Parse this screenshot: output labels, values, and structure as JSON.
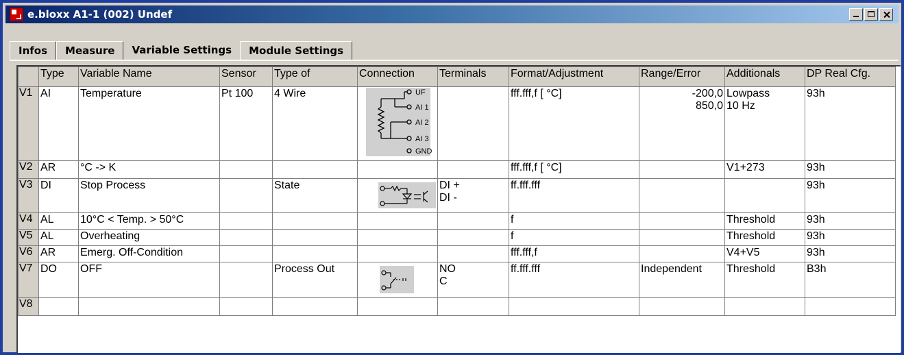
{
  "window": {
    "title": "e.bloxx A1-1 (002) Undef",
    "icon": "icp-app-icon",
    "controls": [
      "minimize",
      "maximize",
      "close"
    ]
  },
  "tabs": [
    {
      "label": "Infos",
      "active": false
    },
    {
      "label": "Measure",
      "active": false
    },
    {
      "label": "Variable Settings",
      "active": true
    },
    {
      "label": "Module Settings",
      "active": false
    }
  ],
  "grid": {
    "columns": [
      "",
      "Type",
      "Variable Name",
      "Sensor",
      "Type of",
      "Connection",
      "Terminals",
      "Format/Adjustment",
      "Range/Error",
      "Additionals",
      "DP Real Cfg."
    ],
    "rows": [
      {
        "id": "V1",
        "type": "AI",
        "name": "Temperature",
        "sensor": "Pt 100",
        "type_of": "4 Wire",
        "connection": "4-wire-rtd-diagram",
        "conn_labels": [
          "UF",
          "AI 1",
          "AI 2",
          "AI 3",
          "GND"
        ],
        "terminals": [
          "",
          ""
        ],
        "format": "fff.fff,f [ °C]",
        "range": [
          "-200,0",
          "850,0"
        ],
        "additionals": [
          "Lowpass",
          "10 Hz"
        ],
        "dp": "93h"
      },
      {
        "id": "V2",
        "type": "AR",
        "name": "°C -> K",
        "sensor": "",
        "type_of": "",
        "connection": "",
        "terminals": [
          "",
          ""
        ],
        "format": "fff.fff,f [ °C]",
        "range": [
          "",
          ""
        ],
        "additionals": [
          "V1+273",
          ""
        ],
        "dp": "93h"
      },
      {
        "id": "V3",
        "type": "DI",
        "name": "Stop Process",
        "sensor": "",
        "type_of": "State",
        "connection": "optocoupler-input-diagram",
        "terminals": [
          "DI +",
          "DI -"
        ],
        "format": "ff.fff.fff",
        "range": [
          "",
          ""
        ],
        "additionals": [
          "",
          ""
        ],
        "dp": "93h"
      },
      {
        "id": "V4",
        "type": "AL",
        "name": "10°C < Temp. > 50°C",
        "sensor": "",
        "type_of": "",
        "connection": "",
        "terminals": [
          "",
          ""
        ],
        "format": "f",
        "range": [
          "",
          ""
        ],
        "additionals": [
          "Threshold",
          ""
        ],
        "dp": "93h"
      },
      {
        "id": "V5",
        "type": "AL",
        "name": "Overheating",
        "sensor": "",
        "type_of": "",
        "connection": "",
        "terminals": [
          "",
          ""
        ],
        "format": "f",
        "range": [
          "",
          ""
        ],
        "additionals": [
          "Threshold",
          ""
        ],
        "dp": "93h"
      },
      {
        "id": "V6",
        "type": "AR",
        "name": "Emerg. Off-Condition",
        "sensor": "",
        "type_of": "",
        "connection": "",
        "terminals": [
          "",
          ""
        ],
        "format": "fff.fff,f",
        "range": [
          "",
          ""
        ],
        "additionals": [
          "V4+V5",
          ""
        ],
        "dp": "93h"
      },
      {
        "id": "V7",
        "type": "DO",
        "name": "OFF",
        "sensor": "",
        "type_of": "Process Out",
        "connection": "relay-output-diagram",
        "terminals": [
          "NO",
          "C"
        ],
        "format": "ff.fff.fff",
        "range": [
          "Independent",
          ""
        ],
        "additionals": [
          "Threshold",
          ""
        ],
        "dp": "B3h"
      },
      {
        "id": "V8",
        "type": "",
        "name": "",
        "sensor": "",
        "type_of": "",
        "connection": "",
        "terminals": [
          "",
          ""
        ],
        "format": "",
        "range": [
          "",
          ""
        ],
        "additionals": [
          "",
          ""
        ],
        "dp": ""
      }
    ]
  }
}
